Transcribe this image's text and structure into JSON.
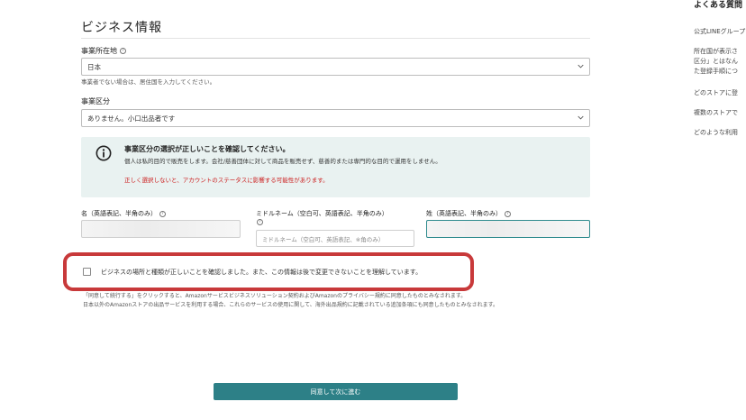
{
  "section": {
    "title": "ビジネス情報"
  },
  "business_location": {
    "label": "事業所在地",
    "value": "日本",
    "hint": "事業者でない場合は、居住国を入力してください。"
  },
  "business_type": {
    "label": "事業区分",
    "value": "ありません。小口出品者です"
  },
  "notice": {
    "title": "事業区分の選択が正しいことを確認してください。",
    "body": "個人は私的目的で販売をします。会社/慈善団体に対して商品を販売せず、慈善的または専門的な目的で運用をしません。",
    "warning": "正しく選択しないと、アカウントのステータスに影響する可能性があります。",
    "colors": {
      "background": "#e9f2f1",
      "warning": "#cc1f1f"
    }
  },
  "name_fields": {
    "first_label": "名（英語表記、半角のみ）",
    "middle_label": "ミドルネーム（空白可、英語表記、半角のみ）",
    "middle_placeholder": "ミドルネーム（空白可、英語表記、※角のみ）",
    "last_label": "姓（英語表記、半角のみ）"
  },
  "confirmation": {
    "text": "ビジネスの場所と種類が正しいことを確認しました。また、この情報は後で変更できないことを理解しています。",
    "checked": false,
    "highlight_color": "#c8393a"
  },
  "legal": {
    "line1": "「同意して続行する」をクリックすると、Amazonサービスビジネスソリューション契約およびAmazonのプライバシー規約に同意したものとみなされます。",
    "line2": "日本以外のAmazonストアの出品サービスを利用する場合、これらのサービスの使用に関して、海外出品規約に記載されている追加条項にも同意したものとみなされます。"
  },
  "submit": {
    "label": "同意して次に進む",
    "color": "#2d8087"
  },
  "faq": {
    "title": "よくある質問",
    "items": [
      "公式LINEグループ",
      "所在国が表示さ",
      "区分」とはなん",
      "た登録手順につ",
      "どのストアに登",
      "複数のストアで",
      "どのような利用"
    ]
  },
  "icons": {
    "help": "help-circle-icon",
    "info": "info-circle-icon",
    "dropdown": "chevron-down-icon"
  }
}
